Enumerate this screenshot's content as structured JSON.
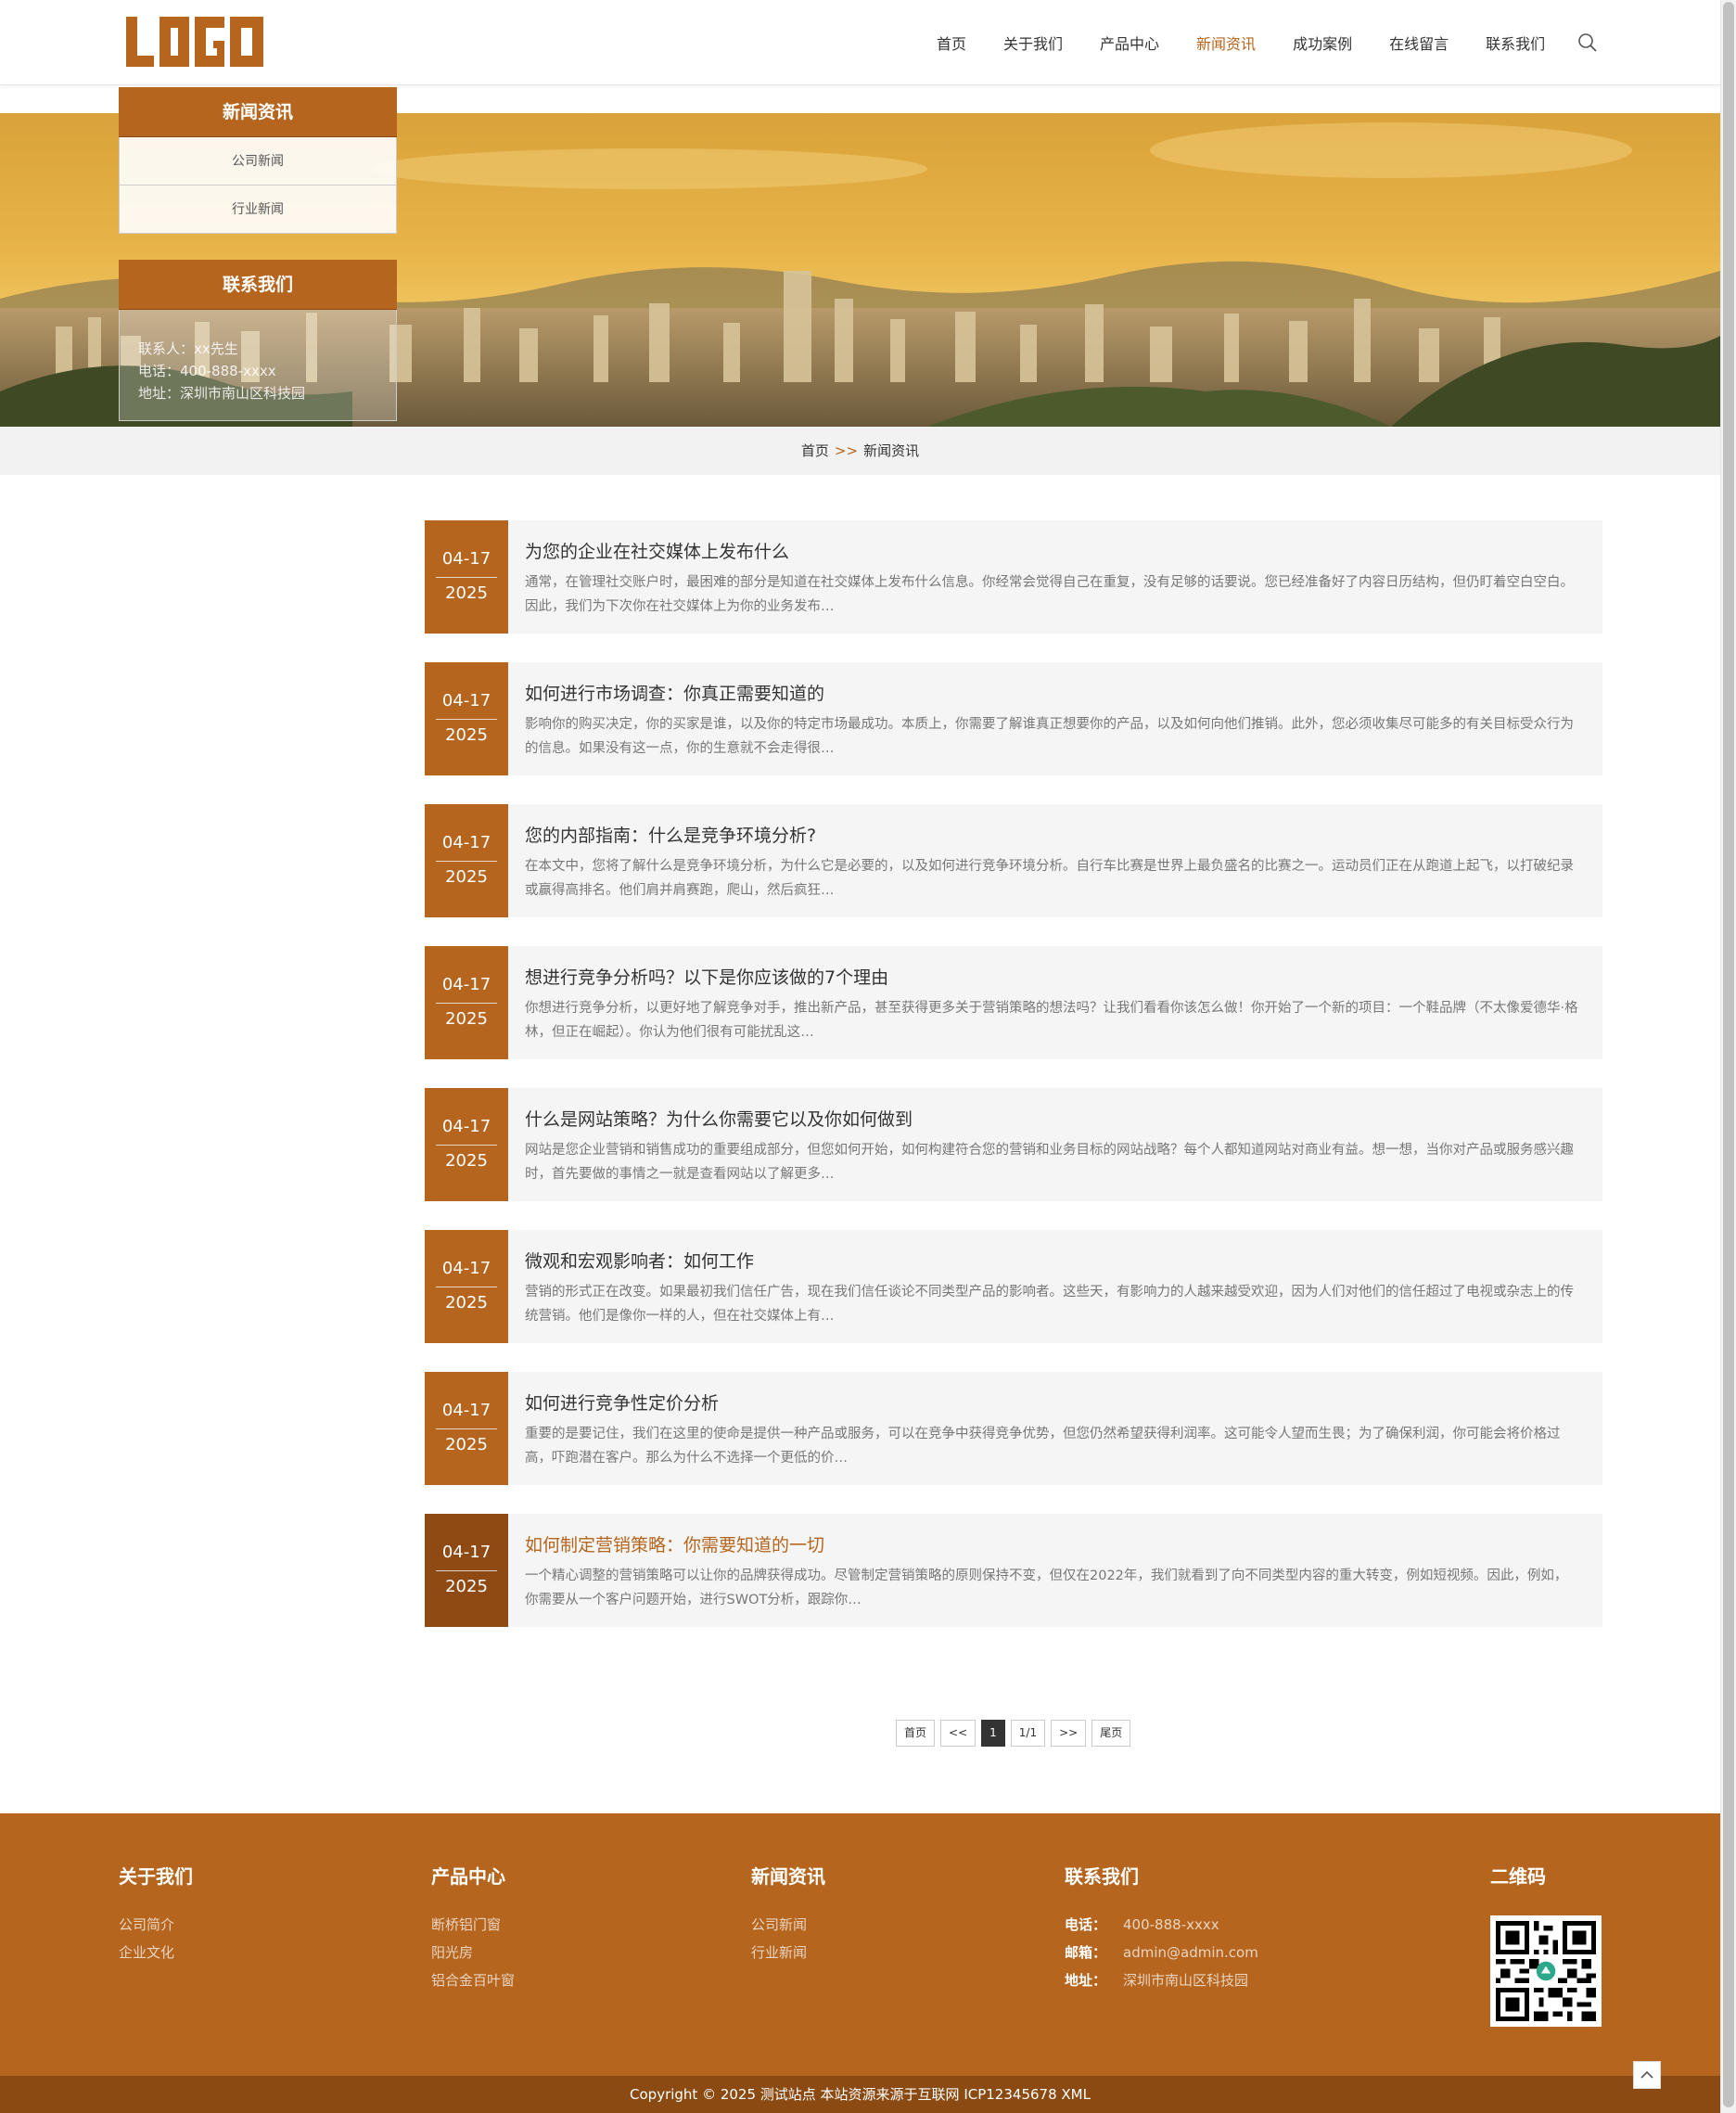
{
  "header": {
    "logo_text": "LOGO",
    "nav": [
      "首页",
      "关于我们",
      "产品中心",
      "新闻资讯",
      "成功案例",
      "在线留言",
      "联系我们"
    ],
    "active_nav": "新闻资讯"
  },
  "sidebar": {
    "title": "新闻资讯",
    "links": [
      "公司新闻",
      "行业新闻"
    ],
    "contact_title": "联系我们",
    "contact_lines": [
      "联系人：xx先生",
      "电话：400-888-xxxx",
      "地址：深圳市南山区科技园"
    ]
  },
  "breadcrumb": {
    "home": "首页",
    "sep": ">>",
    "current": "新闻资讯"
  },
  "news": [
    {
      "md": "04-17",
      "year": "2025",
      "title": "为您的企业在社交媒体上发布什么",
      "desc": "通常，在管理社交账户时，最困难的部分是知道在社交媒体上发布什么信息。你经常会觉得自己在重复，没有足够的话要说。您已经准备好了内容日历结构，但仍盯着空白空白。因此，我们为下次你在社交媒体上为你的业务发布…"
    },
    {
      "md": "04-17",
      "year": "2025",
      "title": "如何进行市场调查：你真正需要知道的",
      "desc": "影响你的购买决定，你的买家是谁，以及你的特定市场最成功。本质上，你需要了解谁真正想要你的产品，以及如何向他们推销。此外，您必须收集尽可能多的有关目标受众行为的信息。如果没有这一点，你的生意就不会走得很…"
    },
    {
      "md": "04-17",
      "year": "2025",
      "title": "您的内部指南：什么是竞争环境分析?",
      "desc": "在本文中，您将了解什么是竞争环境分析，为什么它是必要的，以及如何进行竞争环境分析。自行车比赛是世界上最负盛名的比赛之一。运动员们正在从跑道上起飞，以打破纪录或赢得高排名。他们肩并肩赛跑，爬山，然后疯狂…"
    },
    {
      "md": "04-17",
      "year": "2025",
      "title": "想进行竞争分析吗？以下是你应该做的7个理由",
      "desc": "你想进行竞争分析，以更好地了解竞争对手，推出新产品，甚至获得更多关于营销策略的想法吗？让我们看看你该怎么做！你开始了一个新的项目：一个鞋品牌（不太像爱德华·格林，但正在崛起）。你认为他们很有可能扰乱这…"
    },
    {
      "md": "04-17",
      "year": "2025",
      "title": "什么是网站策略？为什么你需要它以及你如何做到",
      "desc": "网站是您企业营销和销售成功的重要组成部分，但您如何开始，如何构建符合您的营销和业务目标的网站战略？每个人都知道网站对商业有益。想一想，当你对产品或服务感兴趣时，首先要做的事情之一就是查看网站以了解更多…"
    },
    {
      "md": "04-17",
      "year": "2025",
      "title": "微观和宏观影响者：如何工作",
      "desc": "营销的形式正在改变。如果最初我们信任广告，现在我们信任谈论不同类型产品的影响者。这些天，有影响力的人越来越受欢迎，因为人们对他们的信任超过了电视或杂志上的传统营销。他们是像你一样的人，但在社交媒体上有…"
    },
    {
      "md": "04-17",
      "year": "2025",
      "title": "如何进行竞争性定价分析",
      "desc": "重要的是要记住，我们在这里的使命是提供一种产品或服务，可以在竞争中获得竞争优势，但您仍然希望获得利润率。这可能令人望而生畏；为了确保利润，你可能会将价格过高，吓跑潜在客户。那么为什么不选择一个更低的价…"
    },
    {
      "md": "04-17",
      "year": "2025",
      "title": "如何制定营销策略：你需要知道的一切",
      "desc": "一个精心调整的营销策略可以让你的品牌获得成功。尽管制定营销策略的原则保持不变，但仅在2022年，我们就看到了向不同类型内容的重大转变，例如短视频。因此，例如，你需要从一个客户问题开始，进行SWOT分析，跟踪你…"
    }
  ],
  "pagination": {
    "first": "首页",
    "prev": "<<",
    "current": "1",
    "total": "1/1",
    "next": ">>",
    "last": "尾页"
  },
  "footer": {
    "about": {
      "title": "关于我们",
      "links": [
        "公司简介",
        "企业文化"
      ]
    },
    "products": {
      "title": "产品中心",
      "links": [
        "断桥铝门窗",
        "阳光房",
        "铝合金百叶窗"
      ]
    },
    "newsCol": {
      "title": "新闻资讯",
      "links": [
        "公司新闻",
        "行业新闻"
      ]
    },
    "contact": {
      "title": "联系我们",
      "phone_label": "电话：",
      "phone": "400-888-xxxx",
      "email_label": "邮箱：",
      "email": "admin@admin.com",
      "addr_label": "地址：",
      "addr": "深圳市南山区科技园"
    },
    "qr_title": "二维码",
    "copyright": "Copyright © 2025 测试站点 本站资源来源于互联网 ICP12345678 XML"
  },
  "colors": {
    "accent": "#b5651d",
    "accent_dark": "#8a4a12"
  }
}
